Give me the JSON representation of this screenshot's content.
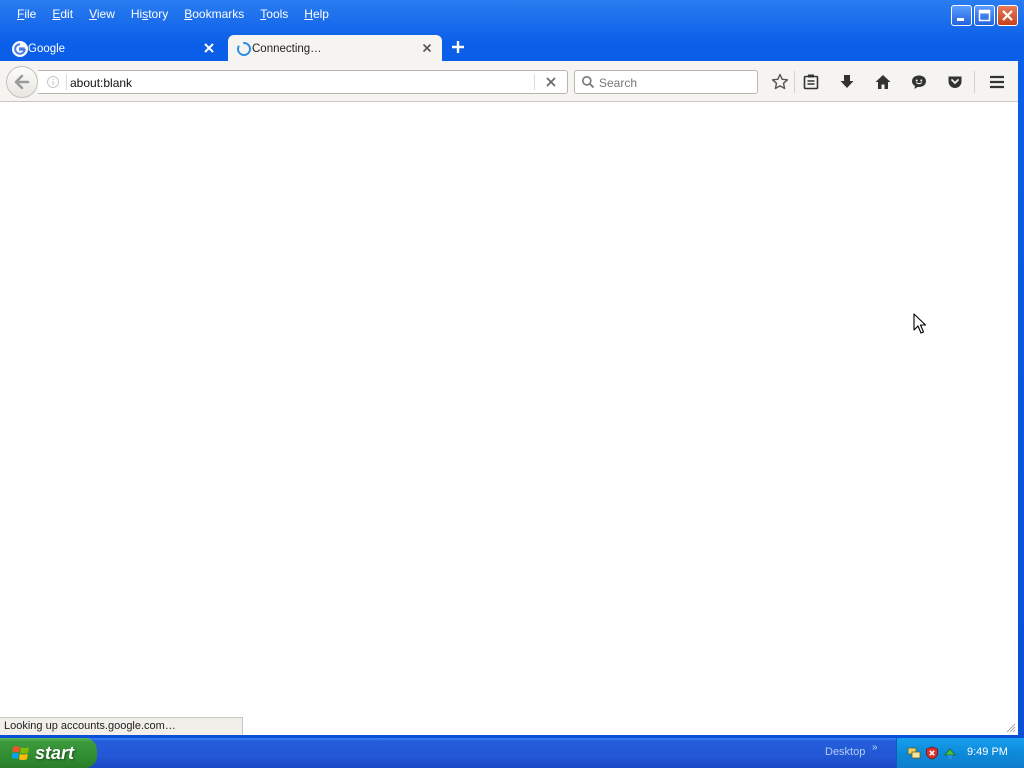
{
  "menu": {
    "items": [
      {
        "label": "File",
        "accel": "F"
      },
      {
        "label": "Edit",
        "accel": "E"
      },
      {
        "label": "View",
        "accel": "V"
      },
      {
        "label": "History",
        "accel": "s"
      },
      {
        "label": "Bookmarks",
        "accel": "B"
      },
      {
        "label": "Tools",
        "accel": "T"
      },
      {
        "label": "Help",
        "accel": "H"
      }
    ]
  },
  "tabs": [
    {
      "label": "Google",
      "icon": "google-favicon-icon",
      "active": false
    },
    {
      "label": "Connecting…",
      "icon": "loading-spinner-icon",
      "active": true
    }
  ],
  "navbar": {
    "url_value": "about:blank",
    "search_placeholder": "Search"
  },
  "status": {
    "text": "Looking up accounts.google.com…"
  },
  "taskbar": {
    "start_label": "start",
    "desktop_label": "Desktop",
    "clock": "9:49 PM"
  },
  "colors": {
    "titlebar_blue": "#0a4fd6",
    "toolbar_bg": "#f5f4f0",
    "start_green": "#3c9a3c",
    "tray_blue": "#0e8ad9",
    "spinner_blue": "#2e8ce6"
  }
}
